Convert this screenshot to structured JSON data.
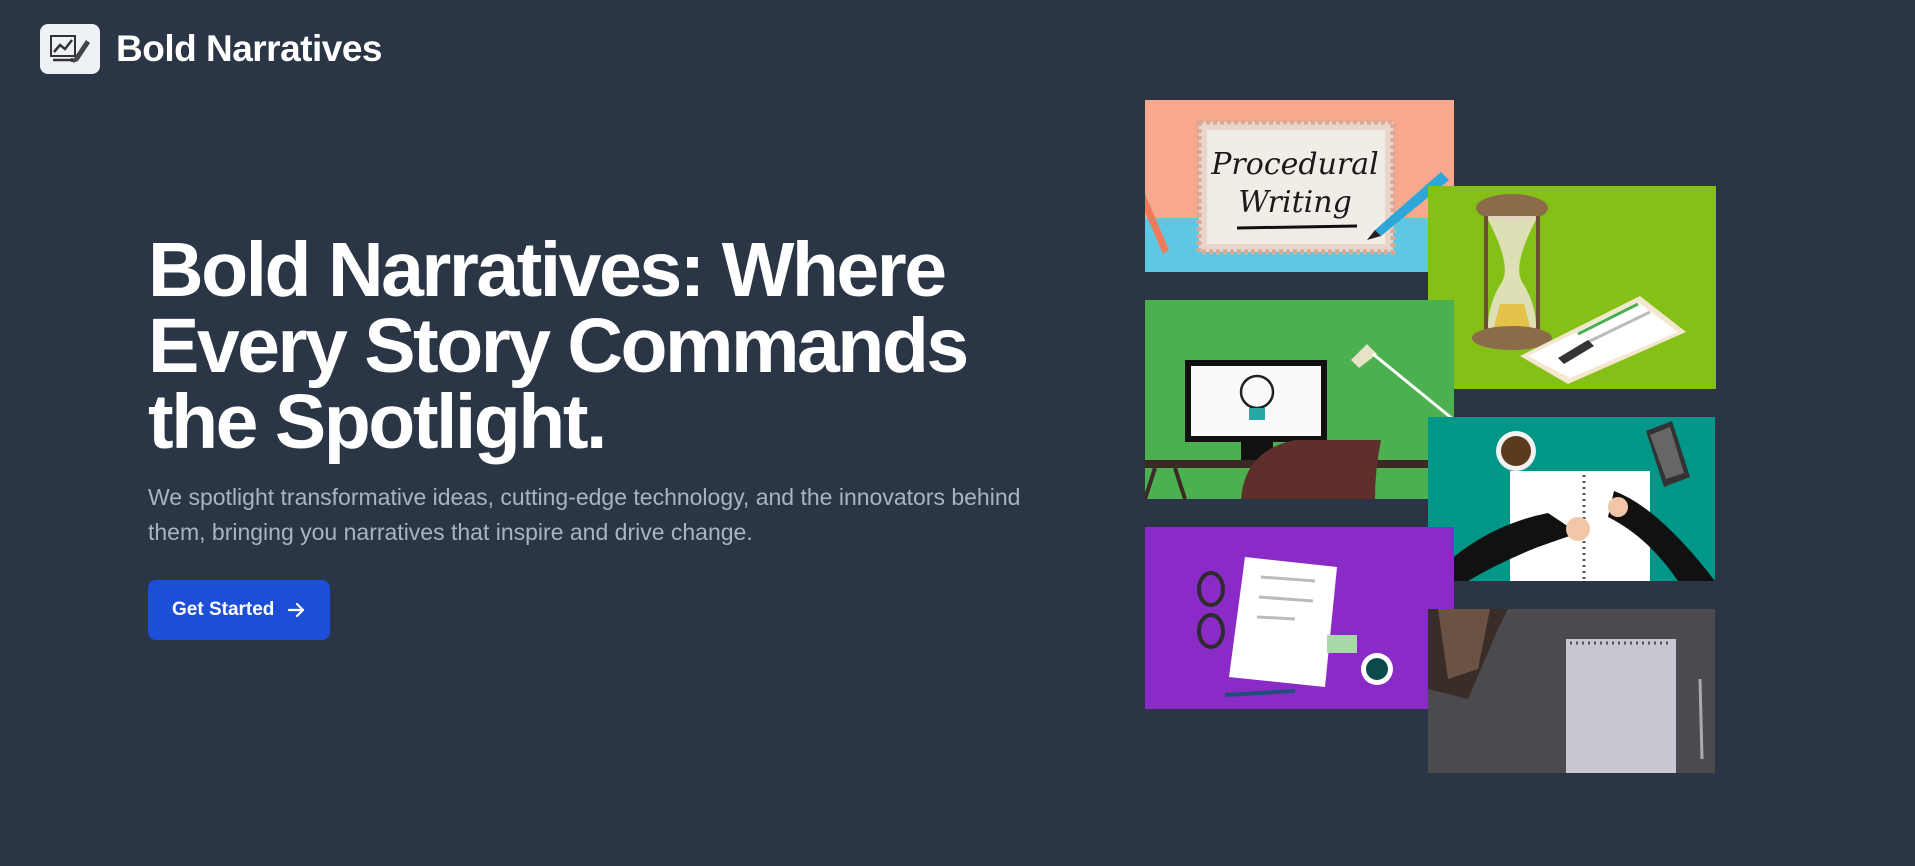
{
  "brand": {
    "name": "Bold Narratives",
    "logo_icon": "chart-pen-logo-icon"
  },
  "hero": {
    "title": "Bold Narratives: Where Every Story Commands the Spotlight.",
    "subtitle": "We spotlight transformative ideas, cutting-edge technology, and the innovators behind them, bringing you narratives that inspire and drive change.",
    "cta_label": "Get Started",
    "cta_icon": "arrow-right-icon"
  },
  "collage": {
    "procedural_card": "Procedural Writing"
  },
  "colors": {
    "background": "#2a3646",
    "cta": "#1d4ed8",
    "subtitle": "#aab3c0"
  }
}
